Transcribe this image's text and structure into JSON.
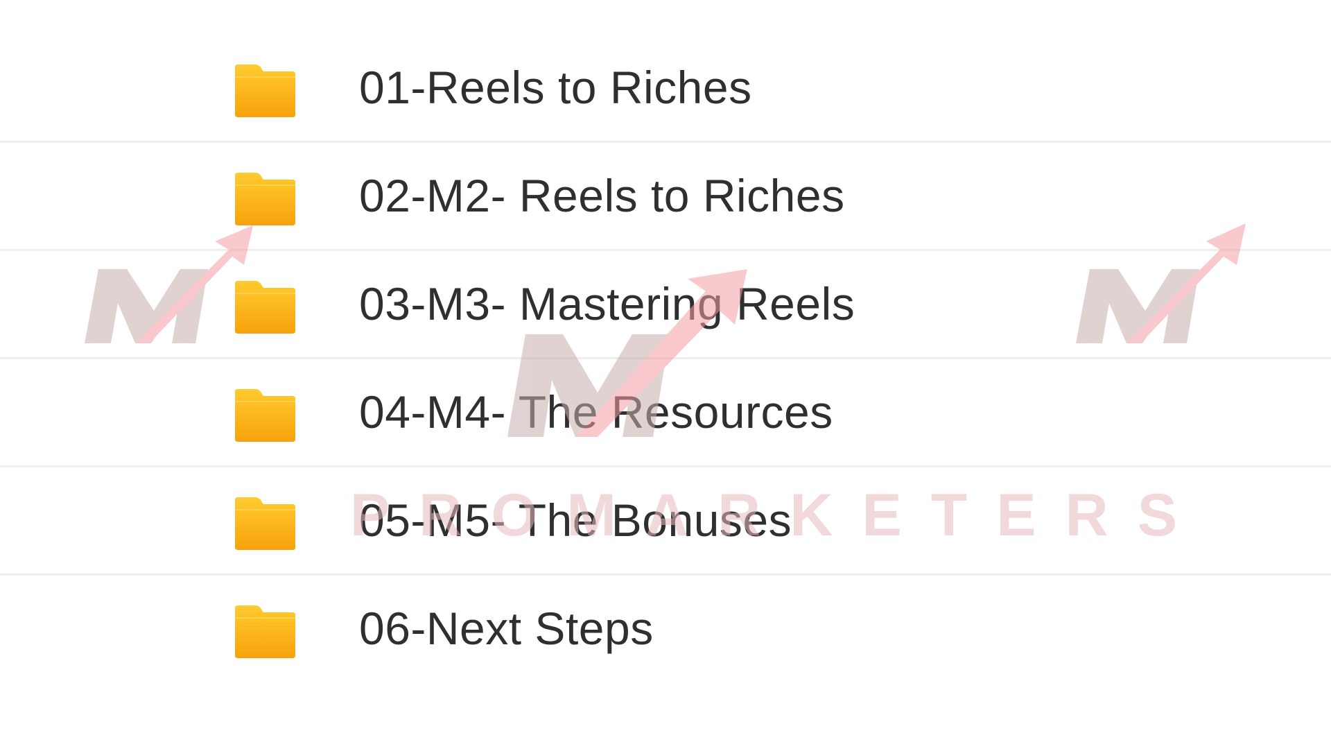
{
  "folders": [
    {
      "name": "01-Reels to Riches",
      "icon": "folder-icon"
    },
    {
      "name": "02-M2- Reels to Riches",
      "icon": "folder-icon"
    },
    {
      "name": "03-M3- Mastering Reels",
      "icon": "folder-icon"
    },
    {
      "name": "04-M4- The Resources",
      "icon": "folder-icon"
    },
    {
      "name": "05-M5- The Bonuses",
      "icon": "folder-icon"
    },
    {
      "name": "06-Next Steps",
      "icon": "folder-icon"
    }
  ],
  "watermark": {
    "text": "PROMARKETERS",
    "logo": "m-arrow-logo"
  },
  "colors": {
    "folder_top": "#ffcb2e",
    "folder_bottom": "#f7a20d",
    "text": "#2f2f2f",
    "divider": "#eeeeee",
    "watermark_gray": "#d4c4c4",
    "watermark_pink": "#f4a7ad"
  }
}
